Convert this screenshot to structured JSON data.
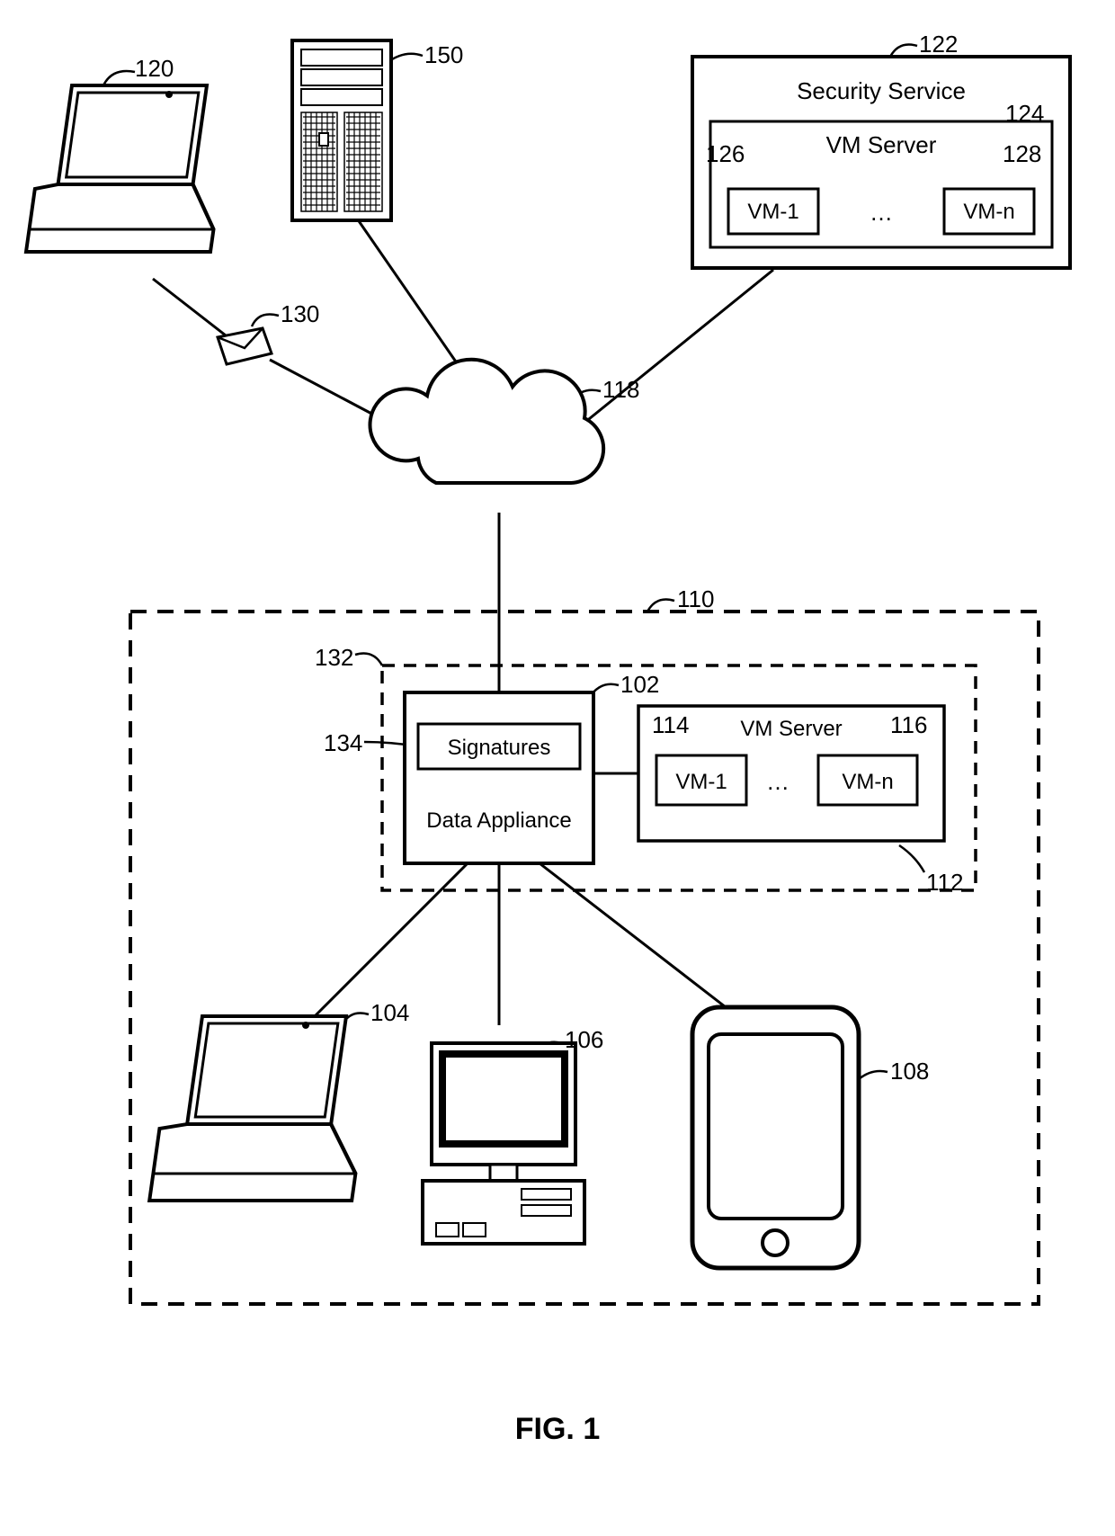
{
  "figure_caption": "FIG. 1",
  "refs": {
    "laptop_top": "120",
    "server_tower": "150",
    "envelope": "130",
    "cloud": "118",
    "security_service": "122",
    "vm_server_top": "124",
    "vm1_top": "126",
    "vmn_top": "128",
    "enterprise_outer": "110",
    "appliance_group": "132",
    "data_appliance": "102",
    "signatures": "134",
    "vm_server_mid": "112",
    "vm1_mid": "114",
    "vmn_mid": "116",
    "laptop_bottom": "104",
    "desktop": "106",
    "phone": "108"
  },
  "labels": {
    "security_service": "Security Service",
    "vm_server": "VM Server",
    "vm1": "VM-1",
    "vmn": "VM-n",
    "ellipsis": "…",
    "signatures": "Signatures",
    "data_appliance": "Data Appliance"
  }
}
